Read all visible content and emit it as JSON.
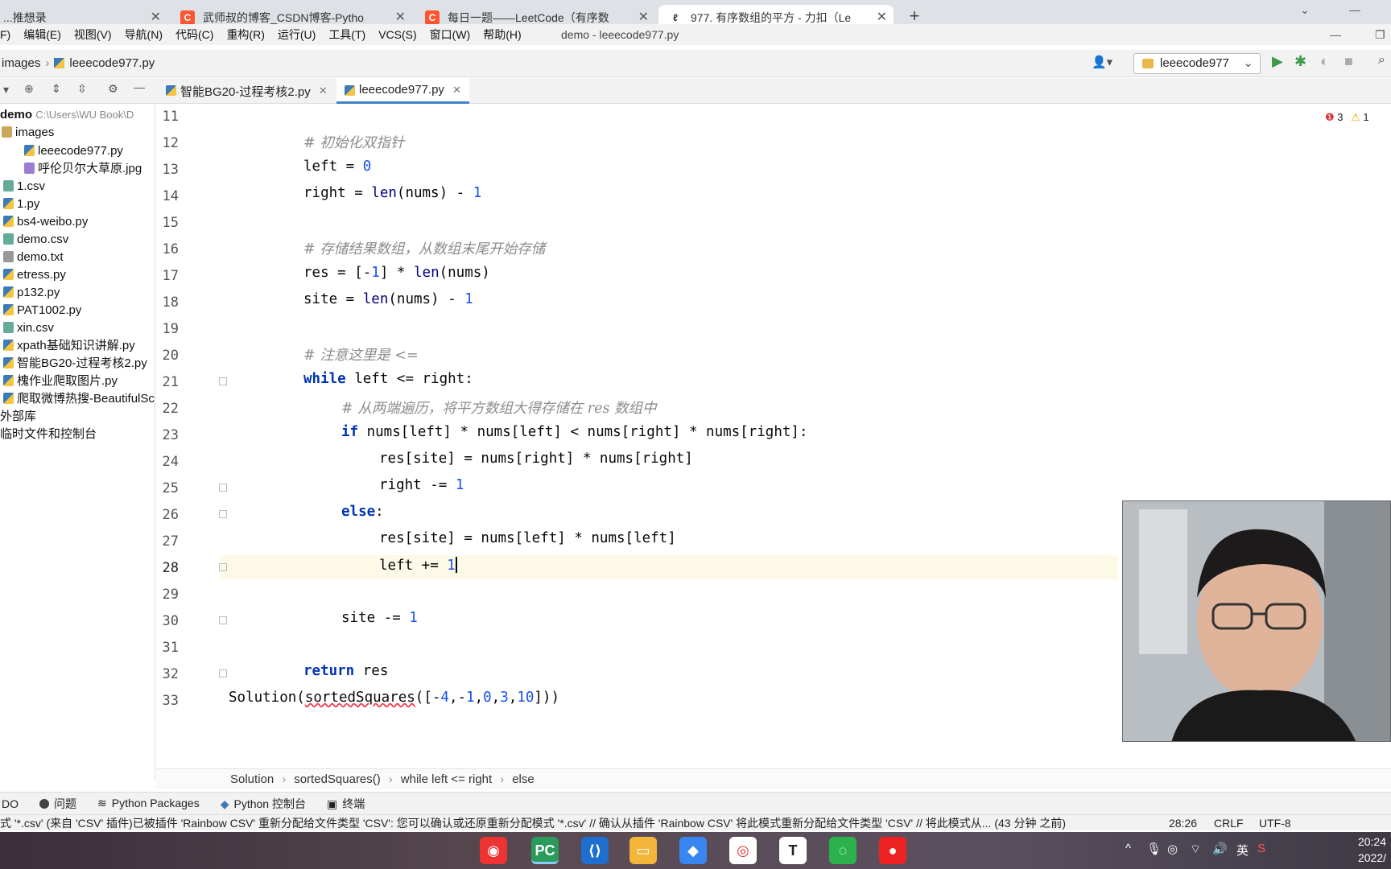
{
  "browser": {
    "tabs": [
      {
        "label": "...推想录"
      },
      {
        "label": "武师叔的博客_CSDN博客-Pytho"
      },
      {
        "label": "每日一题——LeetCode（有序数"
      },
      {
        "label": "977. 有序数组的平方 - 力扣（Le"
      }
    ]
  },
  "menu": {
    "items": [
      "F)",
      "编辑(E)",
      "视图(V)",
      "导航(N)",
      "代码(C)",
      "重构(R)",
      "运行(U)",
      "工具(T)",
      "VCS(S)",
      "窗口(W)",
      "帮助(H)"
    ],
    "title": "demo - leeecode977.py"
  },
  "navbar": {
    "crumb_folder": "images",
    "crumb_file": "leeecode977.py",
    "run_config": "leeecode977"
  },
  "editor_tabs": [
    {
      "label": "智能BG20-过程考核2.py"
    },
    {
      "label": "leeecode977.py"
    }
  ],
  "inspections": {
    "errors": "3",
    "warnings": "1"
  },
  "project": {
    "root": "demo",
    "root_path": "C:\\Users\\WU Book\\D",
    "items": [
      {
        "label": "images",
        "type": "dir"
      },
      {
        "label": "leeecode977.py",
        "type": "py"
      },
      {
        "label": "呼伦贝尔大草原.jpg",
        "type": "jpg"
      },
      {
        "label": "1.csv",
        "type": "csv"
      },
      {
        "label": "1.py",
        "type": "py"
      },
      {
        "label": "bs4-weibo.py",
        "type": "py"
      },
      {
        "label": "demo.csv",
        "type": "csv"
      },
      {
        "label": "demo.txt",
        "type": "txt"
      },
      {
        "label": "etress.py",
        "type": "py"
      },
      {
        "label": "p132.py",
        "type": "py"
      },
      {
        "label": "PAT1002.py",
        "type": "py"
      },
      {
        "label": "xin.csv",
        "type": "csv"
      },
      {
        "label": "xpath基础知识讲解.py",
        "type": "py"
      },
      {
        "label": "智能BG20-过程考核2.py",
        "type": "py"
      },
      {
        "label": "槐作业爬取图片.py",
        "type": "py"
      },
      {
        "label": "爬取微博热搜-BeautifulSc",
        "type": "py"
      },
      {
        "label": "外部库",
        "type": "none"
      },
      {
        "label": "临时文件和控制台",
        "type": "none"
      }
    ]
  },
  "code": {
    "line_numbers": [
      "11",
      "12",
      "13",
      "14",
      "15",
      "16",
      "17",
      "18",
      "19",
      "20",
      "21",
      "22",
      "23",
      "24",
      "25",
      "26",
      "27",
      "28",
      "29",
      "30",
      "31",
      "32",
      "33"
    ],
    "l12": "# 初始化双指针",
    "l13_a": "left = ",
    "l13_n": "0",
    "l14_a": "right = ",
    "l14_f": "len",
    "l14_b": "(nums) - ",
    "l14_n": "1",
    "l16": "# 存储结果数组，从数组末尾开始存储",
    "l17_a": "res = [-",
    "l17_n": "1",
    "l17_b": "] * ",
    "l17_f": "len",
    "l17_c": "(nums)",
    "l18_a": "site = ",
    "l18_f": "len",
    "l18_b": "(nums) - ",
    "l18_n": "1",
    "l20": "# 注意这里是 <=",
    "l21_k": "while",
    "l21_a": " left <= right:",
    "l22": "# 从两端遍历，将平方数组大得存储在 res 数组中",
    "l23_k": "if",
    "l23_a": " nums[left] * nums[left] < nums[right] * nums[right]:",
    "l24": "res[site] = nums[right] * nums[right]",
    "l25_a": "right -= ",
    "l25_n": "1",
    "l26_k": "else",
    "l26_a": ":",
    "l27": "res[site] = nums[left] * nums[left]",
    "l28_a": "left += ",
    "l28_n": "1",
    "l30_a": "site -= ",
    "l30_n": "1",
    "l32_k": "return",
    "l32_a": " res",
    "l33_a": "Solution(",
    "l33_e": "sortedSquares",
    "l33_b": "([-",
    "l33_n1": "4",
    "l33_c1": ",-",
    "l33_n2": "1",
    "l33_c2": ",",
    "l33_n3": "0",
    "l33_c3": ",",
    "l33_n4": "3",
    "l33_c4": ",",
    "l33_n5": "10",
    "l33_d": "]))"
  },
  "breadcrumb": [
    "Solution",
    "sortedSquares()",
    "while left <= right",
    "else"
  ],
  "toolwindows": [
    "DO",
    "问题",
    "Python Packages",
    "Python 控制台",
    "终端"
  ],
  "status": {
    "message": "式 '*.csv' (来自 'CSV' 插件)已被插件 'Rainbow CSV' 重新分配给文件类型 'CSV': 您可以确认或还原重新分配模式 '*.csv' // 确认从插件 'Rainbow CSV' 将此模式重新分配给文件类型 'CSV' // 将此模式从... (43 分钟 之前)",
    "position": "28:26",
    "line_sep": "CRLF",
    "encoding": "UTF-8"
  },
  "taskbar": {
    "ime": "英",
    "time": "20:24",
    "date": "2022/"
  },
  "colors": {
    "accent": "#4083c9",
    "keyword": "#0033b3",
    "number": "#1750eb",
    "comment": "#8c8c8c"
  }
}
